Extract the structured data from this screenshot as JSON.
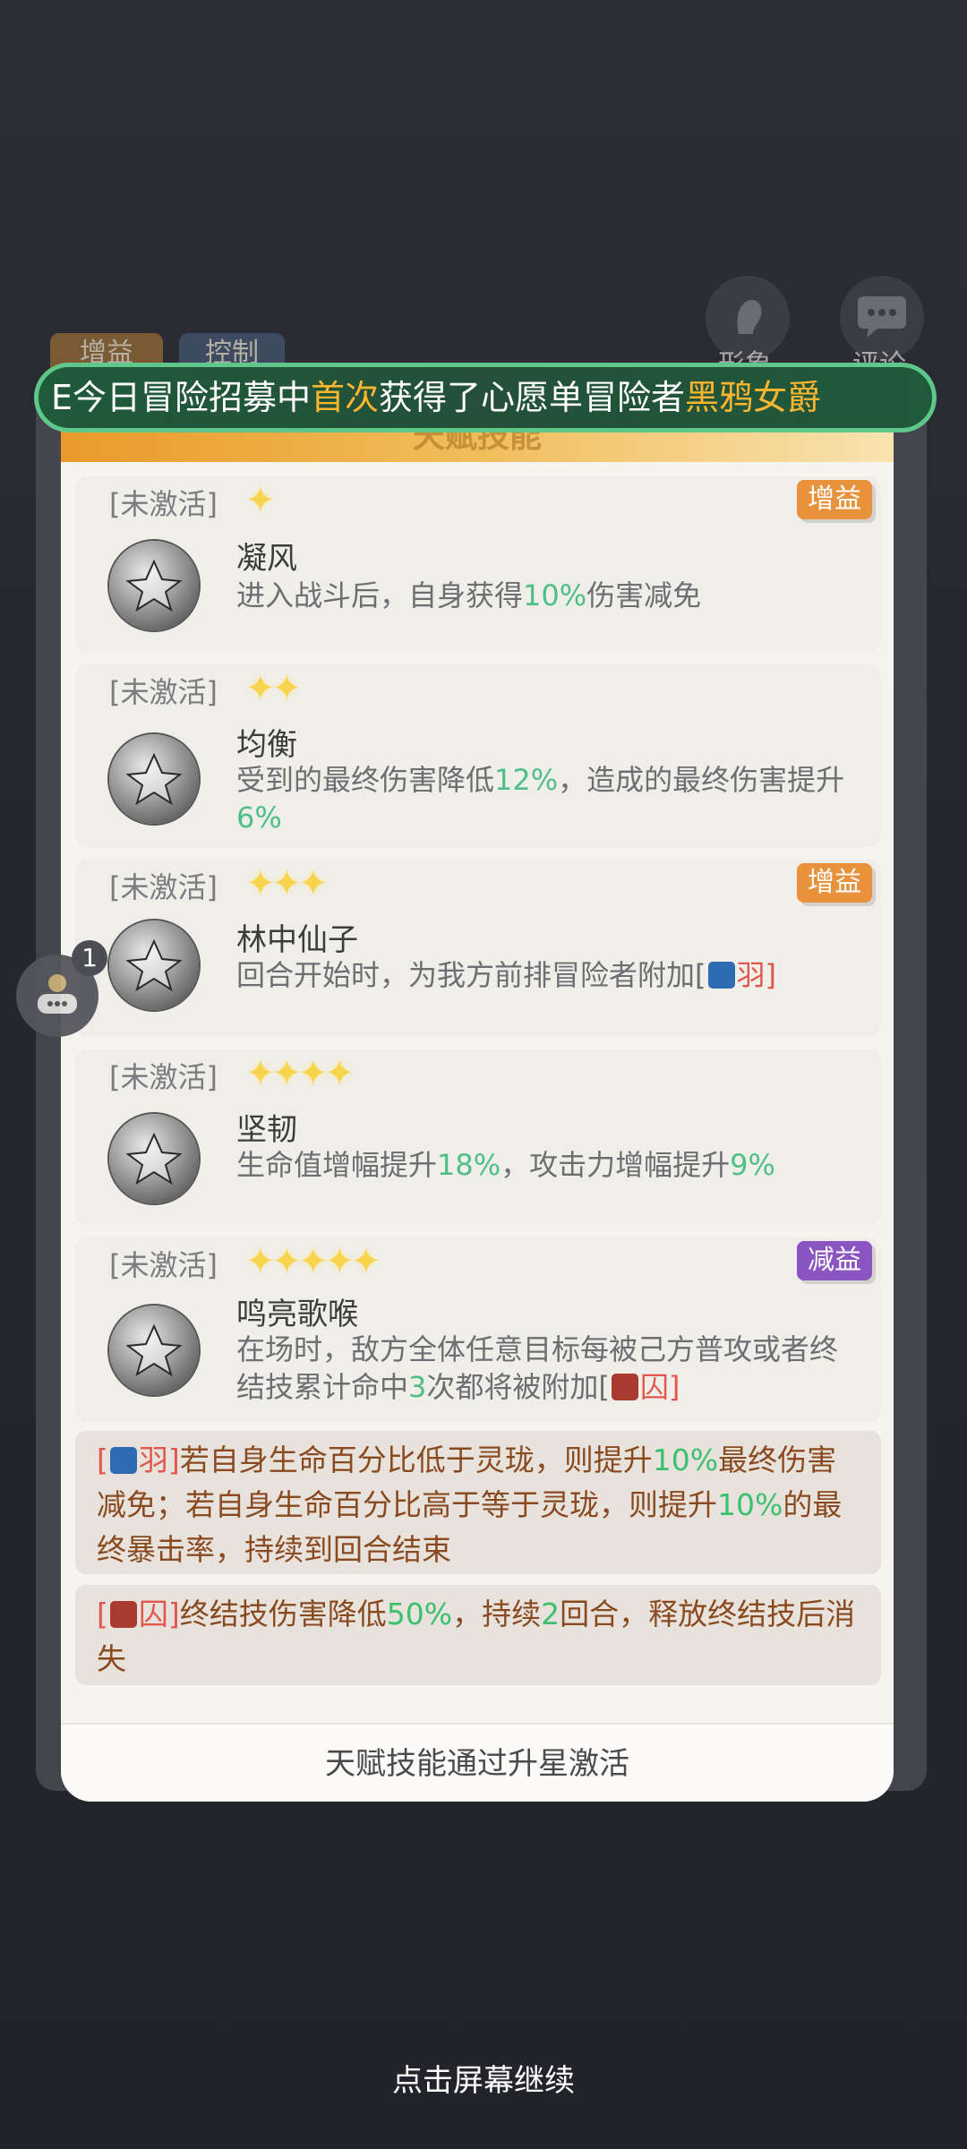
{
  "background": {
    "tabs": [
      "增益",
      "控制"
    ],
    "side_buttons": [
      {
        "label": "形象",
        "icon": "portrait-icon"
      },
      {
        "label": "评论",
        "icon": "chat-bubble-icon"
      }
    ]
  },
  "banner": {
    "prefix": "E今日冒险招募中",
    "highlight1": "首次",
    "middle": "获得了心愿单冒险者",
    "highlight2": "黑鸦女爵"
  },
  "dialog": {
    "title": "天赋技能",
    "talents": [
      {
        "status": "[未激活]",
        "stars": "✦",
        "star_count": 1,
        "tag": "增益",
        "name": "凝风",
        "desc_parts": [
          {
            "t": "进入战斗后，自身获得"
          },
          {
            "t": "10%",
            "c": "g"
          },
          {
            "t": "伤害减免"
          }
        ]
      },
      {
        "status": "[未激活]",
        "stars": "✦✦",
        "star_count": 2,
        "tag": "",
        "name": "均衡",
        "desc_parts": [
          {
            "t": "受到的最终伤害降低"
          },
          {
            "t": "12%",
            "c": "g"
          },
          {
            "t": "，造成的最终伤害提升"
          },
          {
            "t": "6%",
            "c": "g"
          }
        ]
      },
      {
        "status": "[未激活]",
        "stars": "✦✦✦",
        "star_count": 3,
        "tag": "增益",
        "name": "林中仙子",
        "desc_parts": [
          {
            "t": "回合开始时，为我方前排冒险者附加"
          },
          {
            "t": "["
          },
          {
            "icon": "blue"
          },
          {
            "t": "羽]",
            "c": "r"
          }
        ]
      },
      {
        "status": "[未激活]",
        "stars": "✦✦✦✦",
        "star_count": 4,
        "tag": "",
        "name": "坚韧",
        "desc_parts": [
          {
            "t": "生命值增幅提升"
          },
          {
            "t": "18%",
            "c": "g"
          },
          {
            "t": "，攻击力增幅提升"
          },
          {
            "t": "9%",
            "c": "g"
          }
        ]
      },
      {
        "status": "[未激活]",
        "stars": "✦✦✦✦✦",
        "star_count": 5,
        "tag": "减益",
        "name": "鸣亮歌喉",
        "desc_parts": [
          {
            "t": "在场时，敌方全体任意目标每被己方普攻或者终结技累计命中"
          },
          {
            "t": "3",
            "c": "g"
          },
          {
            "t": "次都将被附加"
          },
          {
            "t": "["
          },
          {
            "icon": "red"
          },
          {
            "t": "囚]",
            "c": "r"
          }
        ]
      }
    ],
    "notes": [
      {
        "parts": [
          {
            "t": "[",
            "c": "r"
          },
          {
            "icon": "blue"
          },
          {
            "t": "羽]",
            "c": "r"
          },
          {
            "t": "若自身生命百分比低于灵珑，则提升"
          },
          {
            "t": "10%",
            "c": "g"
          },
          {
            "t": "最终伤害减免；若自身生命百分比高于等于灵珑，则提升"
          },
          {
            "t": "10%",
            "c": "g"
          },
          {
            "t": "的最终暴击率，持续到回合结束"
          }
        ]
      },
      {
        "parts": [
          {
            "t": "[",
            "c": "r"
          },
          {
            "icon": "red"
          },
          {
            "t": "囚]",
            "c": "r"
          },
          {
            "t": "终结技伤害降低"
          },
          {
            "t": "50%",
            "c": "g"
          },
          {
            "t": "，持续"
          },
          {
            "t": "2",
            "c": "g"
          },
          {
            "t": "回合，释放终结技后消失"
          }
        ]
      }
    ],
    "footer": "天赋技能通过升星激活"
  },
  "float_badge": "1",
  "continue_hint": "点击屏幕继续",
  "colors": {
    "buff_tag": "#e8923c",
    "debuff_tag": "#8a55c0",
    "highlight_green": "#4fbf86",
    "highlight_red": "#e2564e",
    "banner_gold": "#ffb52e"
  }
}
